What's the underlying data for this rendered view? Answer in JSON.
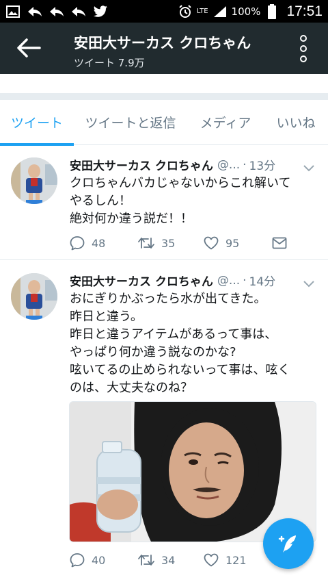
{
  "status_bar": {
    "network": "LTE",
    "battery": "100%",
    "time": "17:51"
  },
  "header": {
    "title": "安田大サーカス クロちゃん",
    "subtitle": "ツイート 7.9万"
  },
  "tabs": [
    {
      "label": "ツイート",
      "active": true
    },
    {
      "label": "ツイートと返信",
      "active": false
    },
    {
      "label": "メディア",
      "active": false
    },
    {
      "label": "いいね",
      "active": false
    }
  ],
  "tweets": [
    {
      "name": "安田大サーカス クロちゃん",
      "handle": "@...",
      "time": "13分",
      "lines": [
        "クロちゃんバカじゃないからこれ解いて",
        "やるしん！",
        "絶対何か違う説だ！！"
      ],
      "replies": "48",
      "retweets": "35",
      "likes": "95"
    },
    {
      "name": "安田大サーカス クロちゃん",
      "handle": "@...",
      "time": "14分",
      "lines": [
        "おにぎりかぶったら水が出てきた。",
        "昨日と違う。",
        "昨日と違うアイテムがあるって事は、",
        "やっぱり何か違う説なのかな?",
        "呟いてるの止められないって事は、呟く",
        "のは、大丈夫なのね？"
      ],
      "replies": "40",
      "retweets": "34",
      "likes": "121"
    }
  ],
  "colors": {
    "accent": "#1da1f2",
    "header_bg": "#212b2f",
    "muted": "#657786"
  }
}
